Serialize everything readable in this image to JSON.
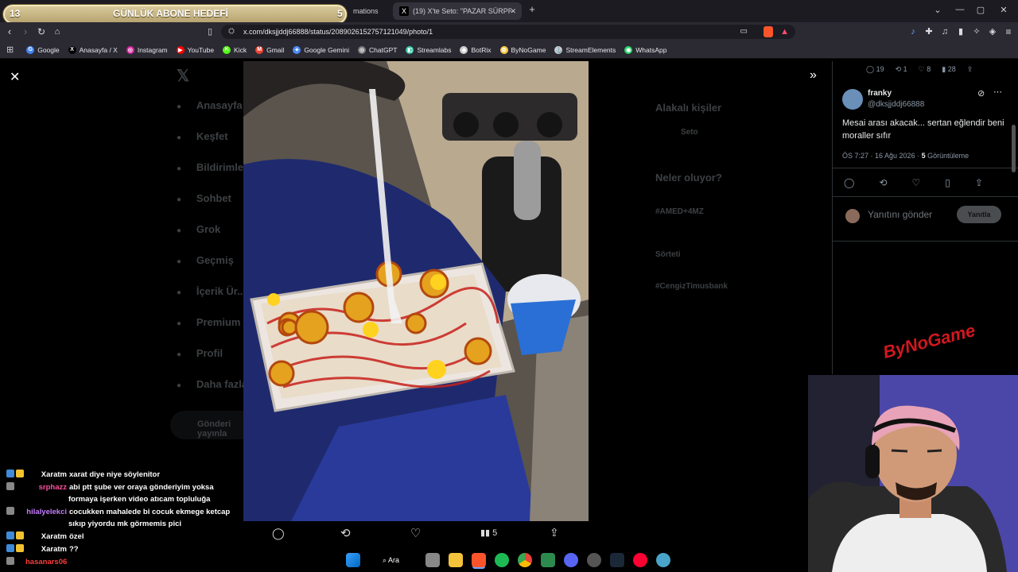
{
  "goal": {
    "left": "13",
    "title": "GÜNLÜK ABONE HEDEFİ",
    "right": "5"
  },
  "tabs": {
    "prev_label": "mations",
    "active_label": "(19) X'te Seto: \"PAZAR SÜRPRİZİ\"",
    "new_tab": "+"
  },
  "window": {
    "menu": "⌄",
    "minimize": "—",
    "maximize": "▢",
    "close": "✕"
  },
  "toolbar": {
    "url": "x.com/dksjjddj66888/status/2089026152757121049/photo/1"
  },
  "bookmarks": [
    {
      "label": "Google",
      "color": "#4285f4",
      "glyph": "G"
    },
    {
      "label": "Anasayfa / X",
      "color": "#000000",
      "glyph": "X"
    },
    {
      "label": "Instagram",
      "color": "#d6249f",
      "glyph": "◎"
    },
    {
      "label": "YouTube",
      "color": "#ff0000",
      "glyph": "▶"
    },
    {
      "label": "Kick",
      "color": "#53fc18",
      "glyph": "K"
    },
    {
      "label": "Gmail",
      "color": "#ea4335",
      "glyph": "M"
    },
    {
      "label": "Google Gemini",
      "color": "#4b8bf5",
      "glyph": "✦"
    },
    {
      "label": "ChatGPT",
      "color": "#777777",
      "glyph": "◎"
    },
    {
      "label": "Streamlabs",
      "color": "#31c3a2",
      "glyph": "◧"
    },
    {
      "label": "BotRix",
      "color": "#cccccc",
      "glyph": "◆"
    },
    {
      "label": "ByNoGame",
      "color": "#f7c948",
      "glyph": "✿"
    },
    {
      "label": "StreamElements",
      "color": "#cccccc",
      "glyph": "⚓"
    },
    {
      "label": "WhatsApp",
      "color": "#25d366",
      "glyph": "◉"
    }
  ],
  "x_sidebar": [
    "Anasayfa",
    "Keşfet",
    "Bildirimler",
    "Sohbet",
    "Grok",
    "Geçmiş",
    "İçerik Ür...",
    "Premium",
    "Profil",
    "Daha fazla"
  ],
  "x_right": {
    "relevant": "Alakalı kişiler",
    "relevant_name": "Seto",
    "whats_on": "Neler oluyor?",
    "trend1": "#AMED+4MZ",
    "trend2": "Sörteti",
    "trend3": "#CengizTimusbank"
  },
  "post_button": "Gönderi yayınla",
  "photo_actions": {
    "views": "5"
  },
  "tweet": {
    "stats": {
      "replies": "19",
      "reposts": "1",
      "likes": "8",
      "views": "28"
    },
    "name": "franky",
    "handle": "@dksjjddj66888",
    "text": "Mesai arası akacak... sertan eğlendir beni moraller sıfır",
    "time": "ÖS 7:27 · 16 Ağu 2026 · ",
    "view_count": "5",
    "view_label": "Görüntüleme",
    "reply_placeholder": "Yanıtını gönder",
    "reply_button": "Yanıtla"
  },
  "watermark": "ByNoGame",
  "chat": [
    {
      "user": "Xaratm",
      "color": "#ffffff",
      "msg": "xarat diye niye söylenitor"
    },
    {
      "user": "srphazz",
      "color": "#ff4fa0",
      "msg": "abi ptt şube ver oraya gönderiyim yoksa"
    },
    {
      "user": "",
      "color": "#ffffff",
      "msg": "formaya işerken video atıcam topluluğa"
    },
    {
      "user": "hilalyelekci",
      "color": "#c77dff",
      "msg": "cocukken mahalede bi cocuk ekmege ketcap"
    },
    {
      "user": "",
      "color": "#ffffff",
      "msg": "sıkıp yiyordu mk görmemis pici"
    },
    {
      "user": "Xaratm",
      "color": "#ffffff",
      "msg": "özel"
    },
    {
      "user": "Xaratm",
      "color": "#ffffff",
      "msg": "??"
    },
    {
      "user": "hasanars06",
      "color": "#ff3b3b",
      "msg": ""
    }
  ],
  "taskbar": {
    "search": "Ara"
  }
}
